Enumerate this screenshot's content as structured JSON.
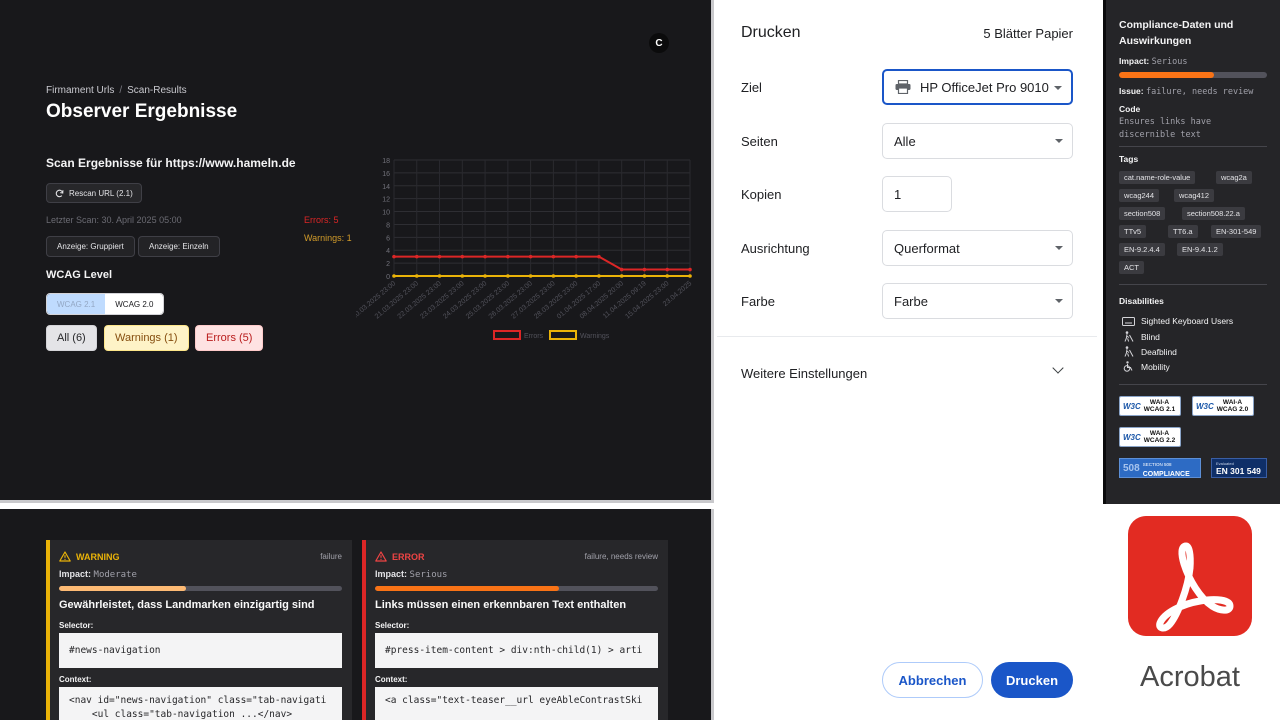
{
  "observer": {
    "avatar": "C",
    "breadcrumb": [
      "Firmament Urls",
      "Scan-Results"
    ],
    "title": "Observer Ergebnisse",
    "scan_heading": "Scan Ergebnisse für https://www.hameln.de",
    "rescan_label": "Rescan URL (2.1)",
    "last_scan": "Letzter Scan: 30. April 2025 05:00",
    "errors_text": "Errors: 5",
    "warnings_text": "Warnings: 1",
    "view_grouped": "Anzeige: Gruppiert",
    "view_single": "Anzeige: Einzeln",
    "wcag_heading": "WCAG Level",
    "wcag_21": "WCAG 2.1",
    "wcag_20": "WCAG 2.0",
    "filter_all": "All (6)",
    "filter_warnings": "Warnings (1)",
    "filter_errors": "Errors (5)",
    "colors": {
      "error": "#dc2626",
      "warning": "#eab308"
    }
  },
  "chart_data": {
    "type": "line",
    "categories": [
      "20.03.2025 23:00",
      "21.03.2025 23:00",
      "22.03.2025 23:00",
      "23.03.2025 23:00",
      "24.03.2025 23:00",
      "25.03.2025 23:00",
      "26.03.2025 23:00",
      "27.03.2025 23:00",
      "28.03.2025 23:00",
      "01.04.2025 17:00",
      "08.04.2025 20:00",
      "11.04.2025 09:19",
      "15.04.2025 23:00",
      "23.04.2025"
    ],
    "series": [
      {
        "name": "Errors",
        "color": "#dc2626",
        "values": [
          3,
          3,
          3,
          3,
          3,
          3,
          3,
          3,
          3,
          3,
          1,
          1,
          1,
          1
        ]
      },
      {
        "name": "Warnings",
        "color": "#eab308",
        "values": [
          0,
          0,
          0,
          0,
          0,
          0,
          0,
          0,
          0,
          0,
          0,
          0,
          0,
          0
        ]
      }
    ],
    "yticks": [
      "0",
      "2",
      "4",
      "6",
      "8",
      "10",
      "12",
      "14",
      "16",
      "18"
    ],
    "ylim": [
      0,
      18
    ],
    "legend": "bottom",
    "grid": true
  },
  "cards": [
    {
      "kind": "WARNING",
      "issue": "failure",
      "impact_label": "Impact:",
      "impact": "Moderate",
      "impact_level": 0.45,
      "color": "#eab308",
      "fill": "#fdba74",
      "description": "Gewährleistet, dass Landmarken einzigartig sind",
      "selector_label": "Selector:",
      "selector": "#news-navigation",
      "context_label": "Context:",
      "context_1": "<nav id=\"news-navigation\" class=\"tab-navigati",
      "context_2": "    <ul class=\"tab-navigation ...</nav>"
    },
    {
      "kind": "ERROR",
      "issue": "failure, needs review",
      "impact_label": "Impact:",
      "impact": "Serious",
      "impact_level": 0.65,
      "color": "#dc2626",
      "fill": "#f97316",
      "description": "Links müssen einen erkennbaren Text enthalten",
      "selector_label": "Selector:",
      "selector": "#press-item-content > div:nth-child(1) > arti",
      "context_label": "Context:",
      "context_1": "<a class=\"text-teaser__url eyeAbleContrastSki"
    }
  ],
  "print": {
    "title": "Drucken",
    "sheets": "5 Blätter Papier",
    "rows": [
      {
        "label": "Ziel",
        "value": "HP OfficeJet Pro 9010",
        "dropdown": true,
        "focus": true,
        "icon": "printer-icon"
      },
      {
        "label": "Seiten",
        "value": "Alle",
        "dropdown": true
      },
      {
        "label": "Kopien",
        "value": "1",
        "dropdown": false
      },
      {
        "label": "Ausrichtung",
        "value": "Querformat",
        "dropdown": true
      },
      {
        "label": "Farbe",
        "value": "Farbe",
        "dropdown": true
      }
    ],
    "more_settings": "Weitere Einstellungen",
    "cancel": "Abbrechen",
    "print": "Drucken",
    "accent": "#1a56c8"
  },
  "compliance": {
    "heading": "Compliance-Daten und Auswirkungen",
    "impact_label": "Impact:",
    "impact": "Serious",
    "impact_level": 0.64,
    "issue_label": "Issue:",
    "issue": "failure, needs review",
    "code_label": "Code",
    "code_text": "Ensures links have discernible text",
    "tags_label": "Tags",
    "tags": [
      "cat.name-role-value",
      "wcag2a",
      "wcag244",
      "wcag412",
      "section508",
      "section508.22.a",
      "TTv5",
      "TT6.a",
      "EN-301-549",
      "EN-9.2.4.4",
      "EN-9.4.1.2",
      "ACT"
    ],
    "disabilities_label": "Disabilities",
    "disabilities": [
      {
        "label": "Sighted Keyboard Users",
        "icon": "keyboard-icon"
      },
      {
        "label": "Blind",
        "icon": "blind-icon"
      },
      {
        "label": "Deafblind",
        "icon": "deafblind-icon"
      },
      {
        "label": "Mobility",
        "icon": "wheelchair-icon"
      }
    ],
    "badges": [
      {
        "w3c": "W3C",
        "wai": "WAI-A",
        "level": "WCAG 2.1"
      },
      {
        "w3c": "W3C",
        "wai": "WAI-A",
        "level": "WCAG 2.0"
      },
      {
        "w3c": "W3C",
        "wai": "WAI-A",
        "level": "WCAG 2.2"
      }
    ],
    "section508": {
      "num": "508",
      "top": "SECTION 508",
      "main": "COMPLIANCE"
    },
    "en": {
      "top": "Evaluated",
      "main": "EN 301 549"
    }
  },
  "acrobat": {
    "name": "Acrobat",
    "color": "#e22b22"
  }
}
